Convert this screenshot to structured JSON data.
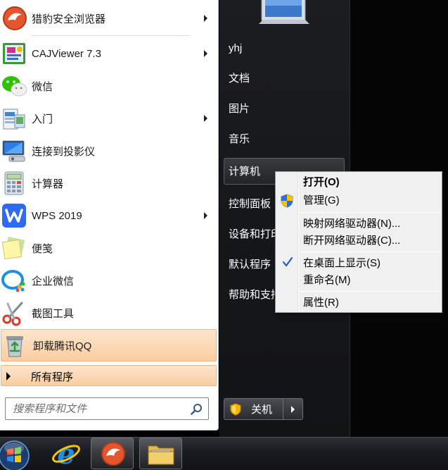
{
  "left_menu": {
    "items": [
      {
        "label": "猎豹安全浏览器",
        "icon": "cheetah-browser-icon",
        "arrow": true
      },
      {
        "label": "CAJViewer 7.3",
        "icon": "cajviewer-icon",
        "arrow": true
      },
      {
        "label": "微信",
        "icon": "wechat-icon",
        "arrow": false
      },
      {
        "label": "入门",
        "icon": "getting-started-icon",
        "arrow": true
      },
      {
        "label": "连接到投影仪",
        "icon": "projector-icon",
        "arrow": false
      },
      {
        "label": "计算器",
        "icon": "calculator-icon",
        "arrow": false
      },
      {
        "label": "WPS 2019",
        "icon": "wps-icon",
        "arrow": true
      },
      {
        "label": "便笺",
        "icon": "sticky-notes-icon",
        "arrow": false
      },
      {
        "label": "企业微信",
        "icon": "wecom-icon",
        "arrow": false
      },
      {
        "label": "截图工具",
        "icon": "snipping-tool-icon",
        "arrow": false
      },
      {
        "label": "卸载腾讯QQ",
        "icon": "recycle-bin-icon",
        "arrow": false,
        "highlighted": true
      }
    ],
    "all_programs": "所有程序",
    "search_placeholder": "搜索程序和文件"
  },
  "right_menu": {
    "items": [
      "yhj",
      "文档",
      "图片",
      "音乐",
      "计算机",
      "控制面板",
      "设备和打印机",
      "默认程序",
      "帮助和支持"
    ],
    "highlighted": "计算机",
    "shutdown_label": "关机"
  },
  "context_menu": {
    "items": [
      {
        "label": "打开(O)",
        "bold": true
      },
      {
        "label": "管理(G)",
        "icon": "uac-shield-icon"
      },
      {
        "label": "映射网络驱动器(N)..."
      },
      {
        "label": "断开网络驱动器(C)..."
      },
      {
        "label": "在桌面上显示(S)",
        "checked": true
      },
      {
        "label": "重命名(M)"
      },
      {
        "label": "属性(R)"
      }
    ]
  },
  "taskbar": {
    "items": [
      "start-orb",
      "internet-explorer-icon",
      "cheetah-browser-icon",
      "file-explorer-icon"
    ],
    "active": "cheetah-browser-icon"
  },
  "colors": {
    "highlight_orange": "#fbcda0",
    "right_pane": "#17181b",
    "wps_blue": "#2f6bf0",
    "checkmark_blue": "#1f5fc4"
  }
}
